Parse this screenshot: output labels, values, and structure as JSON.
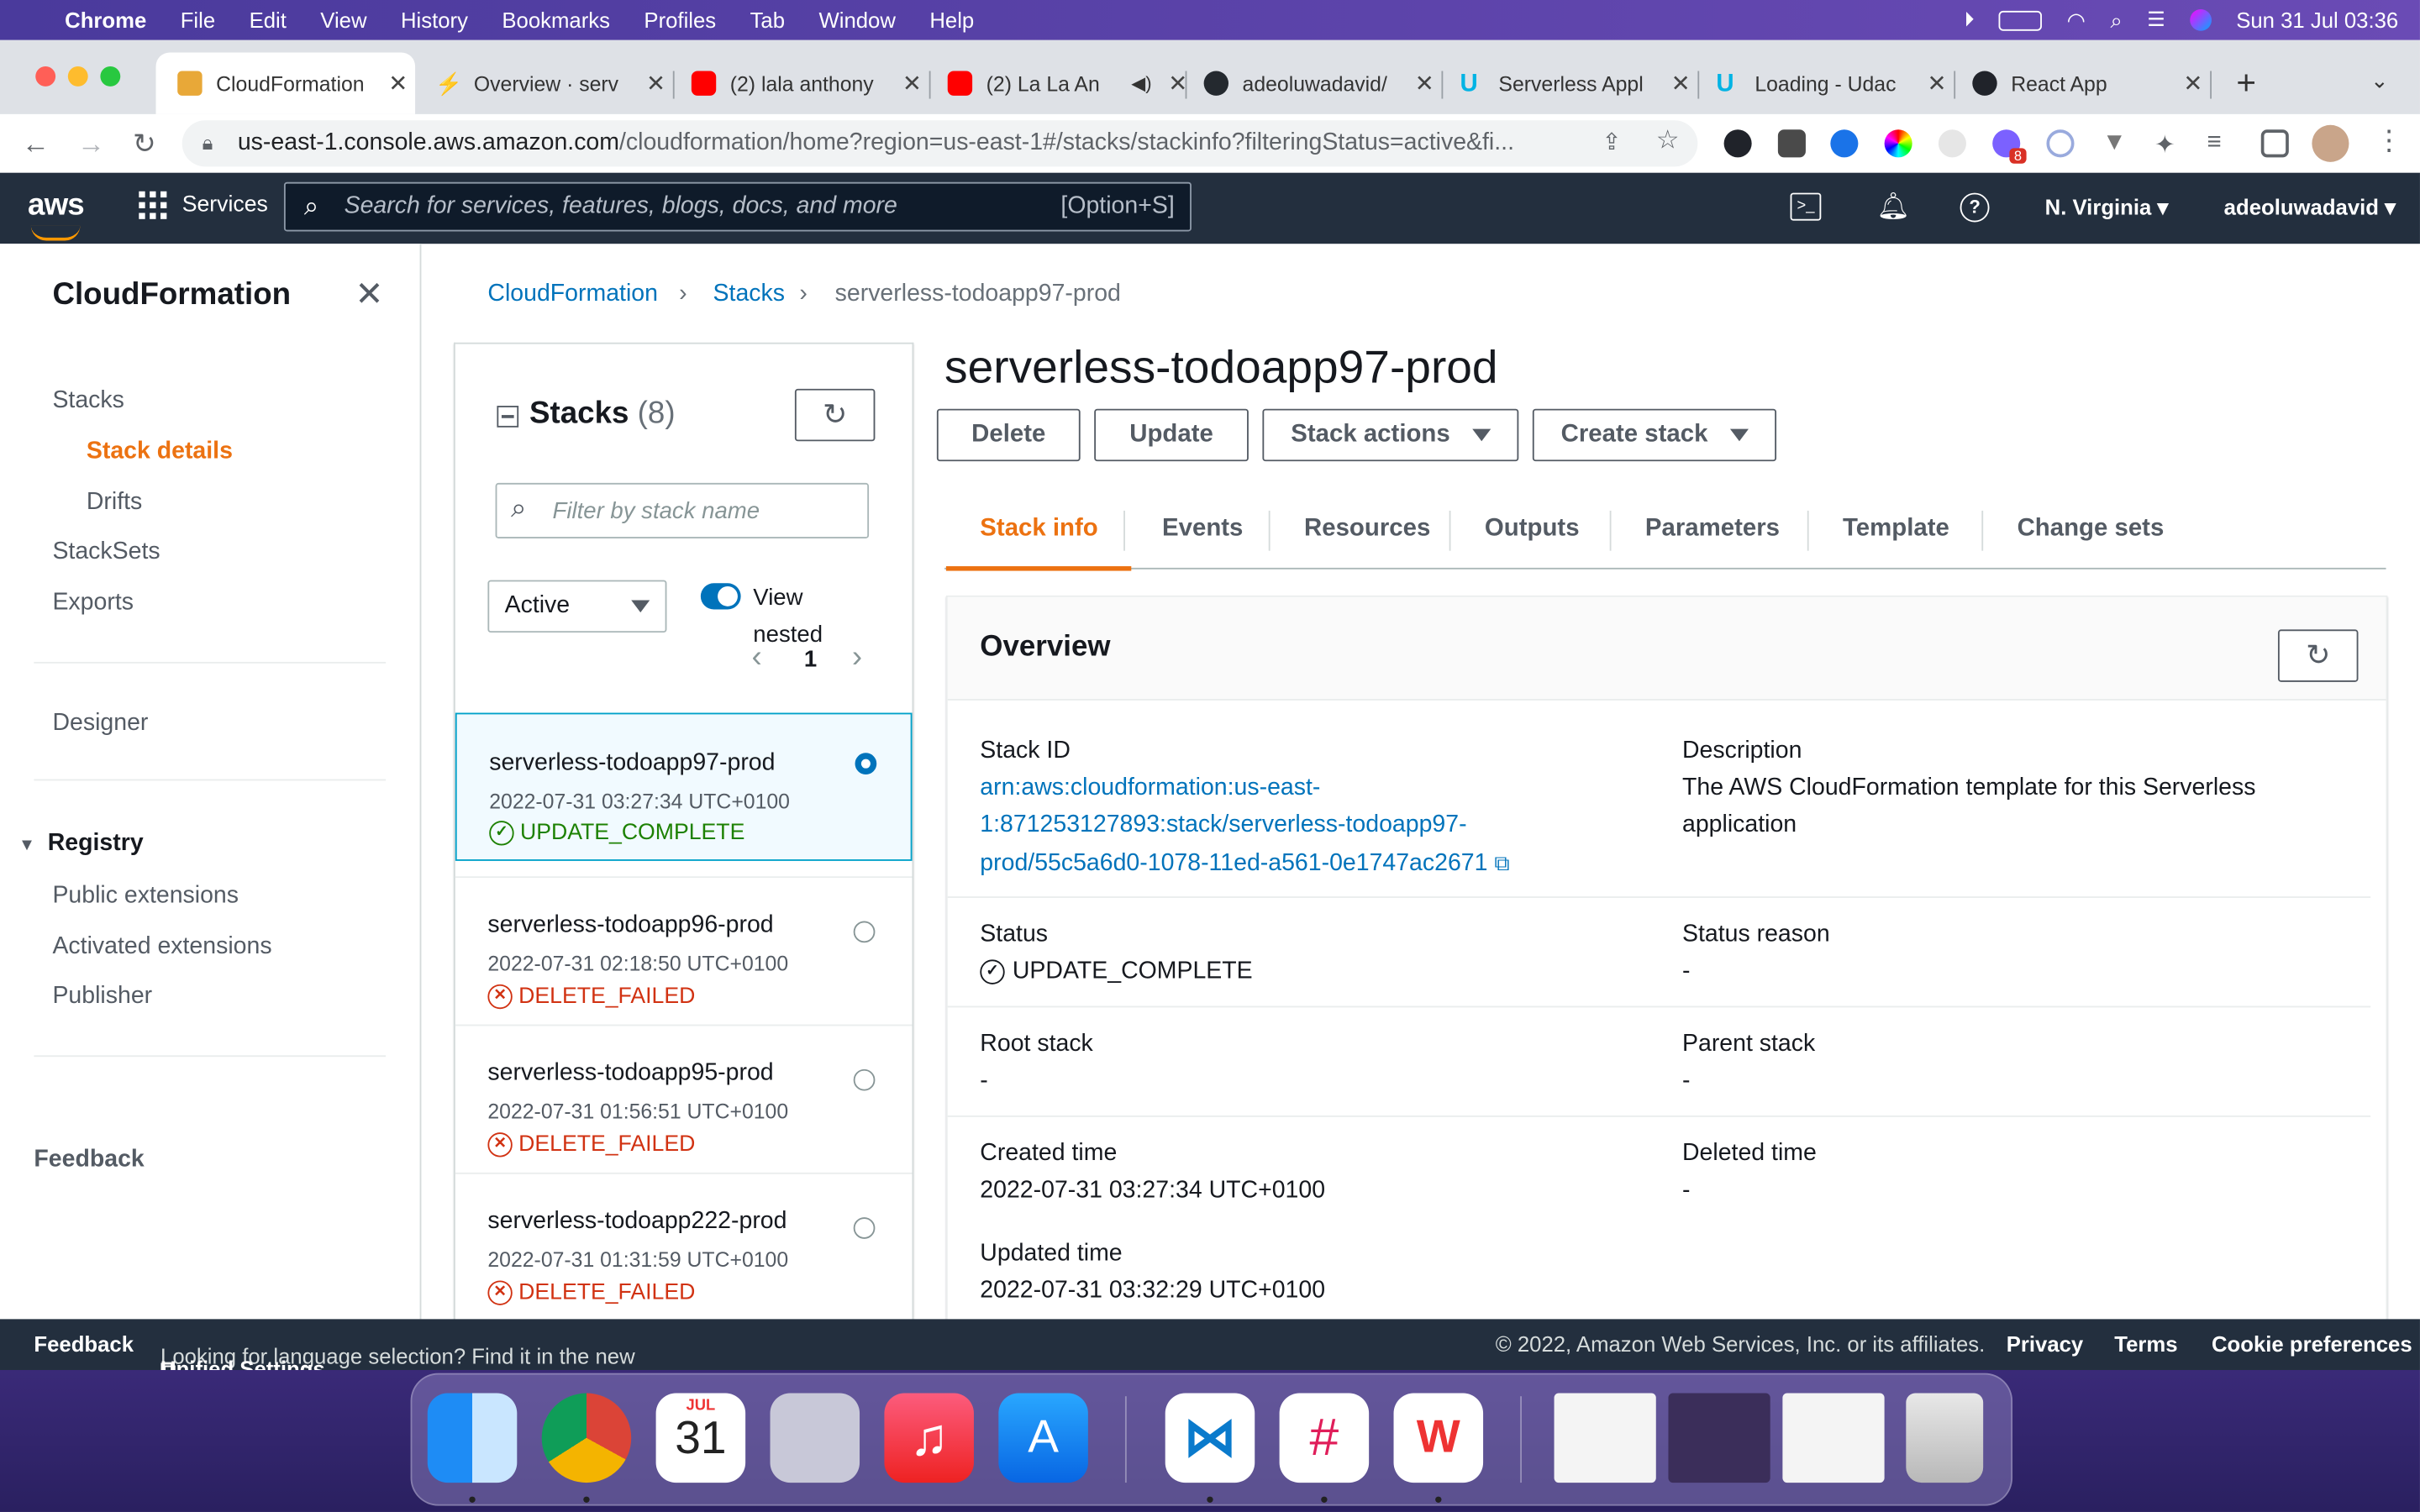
{
  "menubar": {
    "apple": "",
    "items": [
      "Chrome",
      "File",
      "Edit",
      "View",
      "History",
      "Bookmarks",
      "Profiles",
      "Tab",
      "Window",
      "Help"
    ],
    "clock": "Sun 31 Jul  03:36"
  },
  "browser": {
    "tabs": [
      {
        "title": "CloudFormation",
        "icon": "cube-icon"
      },
      {
        "title": "Overview · serv",
        "icon": "serverless-icon"
      },
      {
        "title": "(2) lala anthony",
        "icon": "youtube-icon"
      },
      {
        "title": "(2) La La An",
        "icon": "youtube-icon"
      },
      {
        "title": "adeoluwadavid/",
        "icon": "github-icon"
      },
      {
        "title": "Serverless Appl",
        "icon": "udacity-icon"
      },
      {
        "title": "Loading - Udac",
        "icon": "udacity-icon"
      },
      {
        "title": "React App",
        "icon": "react-icon"
      }
    ],
    "url_host": "us-east-1.console.aws.amazon.com",
    "url_rest": "/cloudformation/home?region=us-east-1#/stacks/stackinfo?filteringStatus=active&fi...",
    "ext_badge": "8"
  },
  "aws_header": {
    "logo": "aws",
    "services": "Services",
    "search_placeholder": "Search for services, features, blogs, docs, and more",
    "search_shortcut": "[Option+S]",
    "region": "N. Virginia",
    "user": "adeoluwadavid"
  },
  "leftnav": {
    "title": "CloudFormation",
    "stacks": "Stacks",
    "stack_details": "Stack details",
    "drifts": "Drifts",
    "stacksets": "StackSets",
    "exports": "Exports",
    "designer": "Designer",
    "registry": "Registry",
    "public_extensions": "Public extensions",
    "activated_extensions": "Activated extensions",
    "publisher": "Publisher",
    "feedback": "Feedback"
  },
  "breadcrumb": {
    "root": "CloudFormation",
    "stacks": "Stacks",
    "current": "serverless-todoapp97-prod"
  },
  "stacks_panel": {
    "title": "Stacks",
    "count": "(8)",
    "filter_placeholder": "Filter by stack name",
    "filter_status": "Active",
    "view_nested_1": "View",
    "view_nested_2": "nested",
    "page": "1",
    "stacks": [
      {
        "name": "serverless-todoapp97-prod",
        "date": "2022-07-31 03:27:34 UTC+0100",
        "status": "UPDATE_COMPLETE",
        "selected": true
      },
      {
        "name": "serverless-todoapp96-prod",
        "date": "2022-07-31 02:18:50 UTC+0100",
        "status": "DELETE_FAILED",
        "selected": false
      },
      {
        "name": "serverless-todoapp95-prod",
        "date": "2022-07-31 01:56:51 UTC+0100",
        "status": "DELETE_FAILED",
        "selected": false
      },
      {
        "name": "serverless-todoapp222-prod",
        "date": "2022-07-31 01:31:59 UTC+0100",
        "status": "DELETE_FAILED",
        "selected": false
      }
    ]
  },
  "main": {
    "title": "serverless-todoapp97-prod",
    "buttons": {
      "delete": "Delete",
      "update": "Update",
      "stack_actions": "Stack actions",
      "create_stack": "Create stack"
    },
    "tabs": [
      "Stack info",
      "Events",
      "Resources",
      "Outputs",
      "Parameters",
      "Template",
      "Change sets"
    ],
    "overview": {
      "title": "Overview",
      "stack_id_label": "Stack ID",
      "stack_id_line1": "arn:aws:cloudformation:us-east-",
      "stack_id_line2": "1:871253127893:stack/serverless-todoapp97-",
      "stack_id_line3": "prod/55c5a6d0-1078-11ed-a561-0e1747ac2671",
      "description_label": "Description",
      "description_line1": "The AWS CloudFormation template for this Serverless",
      "description_line2": "application",
      "status_label": "Status",
      "status_value": "UPDATE_COMPLETE",
      "status_reason_label": "Status reason",
      "status_reason_value": "-",
      "root_stack_label": "Root stack",
      "root_stack_value": "-",
      "parent_stack_label": "Parent stack",
      "parent_stack_value": "-",
      "created_time_label": "Created time",
      "created_time_value": "2022-07-31 03:27:34 UTC+0100",
      "deleted_time_label": "Deleted time",
      "deleted_time_value": "-",
      "updated_time_label": "Updated time",
      "updated_time_value": "2022-07-31 03:32:29 UTC+0100"
    }
  },
  "footer": {
    "feedback": "Feedback",
    "language_text": "Looking for language selection? Find it in the new",
    "unified_settings": "Unified Settings",
    "copyright": "© 2022, Amazon Web Services, Inc. or its affiliates.",
    "privacy": "Privacy",
    "terms": "Terms",
    "cookie": "Cookie preferences"
  },
  "dock": {
    "calendar_month": "JUL",
    "calendar_day": "31",
    "apps": [
      "finder-icon",
      "chrome-icon",
      "calendar-icon",
      "launchpad-icon",
      "music-icon",
      "app-store-icon",
      "vscode-icon",
      "slack-icon",
      "wps-icon",
      "trash-icon"
    ]
  },
  "colors": {
    "aws_header": "#232f3e",
    "accent_orange": "#ec7211",
    "link_blue": "#0073bb",
    "success_green": "#1d8102",
    "error_red": "#d13212"
  }
}
